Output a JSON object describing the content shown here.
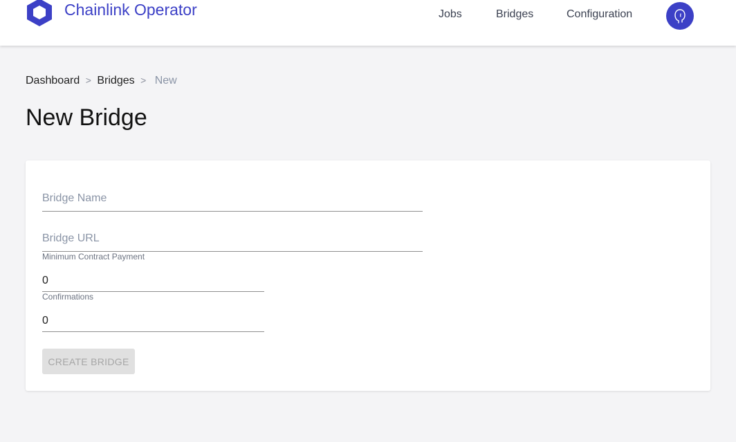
{
  "app": {
    "brand": "Chainlink Operator",
    "logo_icon": "chainlink-hexagon-icon",
    "accent_color": "#3c40c6"
  },
  "nav": {
    "items": [
      {
        "label": "Jobs"
      },
      {
        "label": "Bridges"
      },
      {
        "label": "Configuration"
      }
    ],
    "avatar_icon": "user-avatar-icon"
  },
  "breadcrumb": {
    "items": [
      "Dashboard",
      "Bridges"
    ],
    "separator": ">",
    "current": "New"
  },
  "page": {
    "title": "New Bridge"
  },
  "form": {
    "bridge_name": {
      "placeholder": "Bridge Name",
      "value": ""
    },
    "bridge_url": {
      "placeholder": "Bridge URL",
      "value": ""
    },
    "min_contract_payment": {
      "label": "Minimum Contract Payment",
      "value": "0"
    },
    "confirmations": {
      "label": "Confirmations",
      "value": "0"
    },
    "submit_label": "CREATE BRIDGE"
  }
}
